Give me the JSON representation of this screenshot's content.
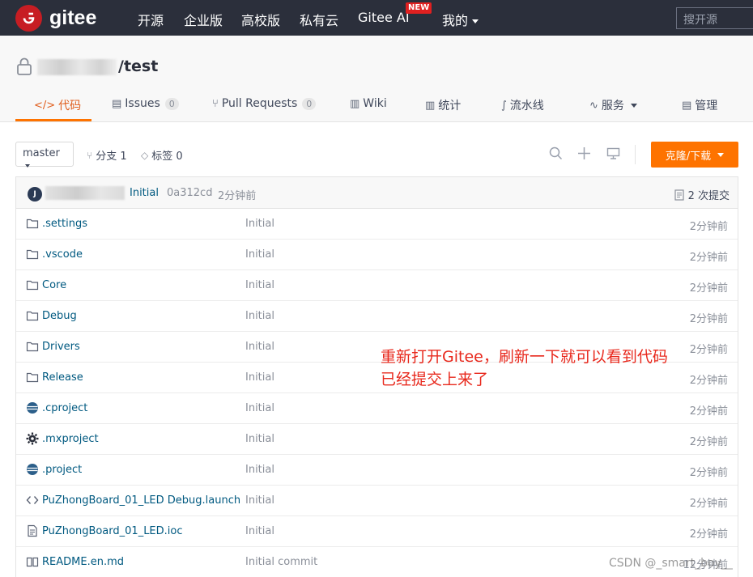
{
  "topnav": {
    "logo_text": "gitee",
    "items": [
      "开源",
      "企业版",
      "高校版",
      "私有云",
      "Gitee AI",
      "我的"
    ],
    "new_badge": "NEW",
    "search_placeholder": "搜开源"
  },
  "repo": {
    "path": "/test",
    "tabs": [
      {
        "icon": "code-icon",
        "label": "代码",
        "active": true
      },
      {
        "icon": "issues-icon",
        "label": "Issues",
        "count": "0"
      },
      {
        "icon": "pull-request-icon",
        "label": "Pull Requests",
        "count": "0"
      },
      {
        "icon": "wiki-icon",
        "label": "Wiki"
      },
      {
        "icon": "stats-icon",
        "label": "统计"
      },
      {
        "icon": "pipeline-icon",
        "label": "流水线"
      },
      {
        "icon": "service-icon",
        "label": "服务"
      },
      {
        "icon": "manage-icon",
        "label": "管理"
      }
    ]
  },
  "toolbar": {
    "branch": "master",
    "branches_label": "分支 1",
    "tags_label": "标签 0",
    "clone_label": "克隆/下载"
  },
  "commit": {
    "avatar_letter": "J",
    "message": "Initial",
    "sha": "0a312cd",
    "time": "2分钟前",
    "count_label": "2 次提交"
  },
  "files": [
    {
      "icon": "folder-icon",
      "name": ".settings",
      "message": "Initial",
      "time": "2分钟前"
    },
    {
      "icon": "folder-icon",
      "name": ".vscode",
      "message": "Initial",
      "time": "2分钟前"
    },
    {
      "icon": "folder-icon",
      "name": "Core",
      "message": "Initial",
      "time": "2分钟前"
    },
    {
      "icon": "folder-icon",
      "name": "Debug",
      "message": "Initial",
      "time": "2分钟前"
    },
    {
      "icon": "folder-icon",
      "name": "Drivers",
      "message": "Initial",
      "time": "2分钟前"
    },
    {
      "icon": "folder-icon",
      "name": "Release",
      "message": "Initial",
      "time": "2分钟前"
    },
    {
      "icon": "eclipse-icon",
      "name": ".cproject",
      "message": "Initial",
      "time": "2分钟前"
    },
    {
      "icon": "gear-icon",
      "name": ".mxproject",
      "message": "Initial",
      "time": "2分钟前"
    },
    {
      "icon": "eclipse-icon",
      "name": ".project",
      "message": "Initial",
      "time": "2分钟前"
    },
    {
      "icon": "code-file-icon",
      "name": "PuZhongBoard_01_LED Debug.launch",
      "message": "Initial",
      "time": "2分钟前"
    },
    {
      "icon": "file-icon",
      "name": "PuZhongBoard_01_LED.ioc",
      "message": "Initial",
      "time": "2分钟前"
    },
    {
      "icon": "book-icon",
      "name": "README.en.md",
      "message": "Initial commit",
      "time": "12分钟前"
    }
  ],
  "annotation": {
    "line1": "重新打开Gitee，刷新一下就可以看到代码",
    "line2": "已经提交上来了"
  },
  "watermark": "CSDN @_smart_boy__",
  "colors": {
    "topbar": "#2b2f3b",
    "accent_orange": "#fe7300",
    "link": "#005980",
    "annotation_red": "#e8281c",
    "logo_red": "#c71d23"
  }
}
